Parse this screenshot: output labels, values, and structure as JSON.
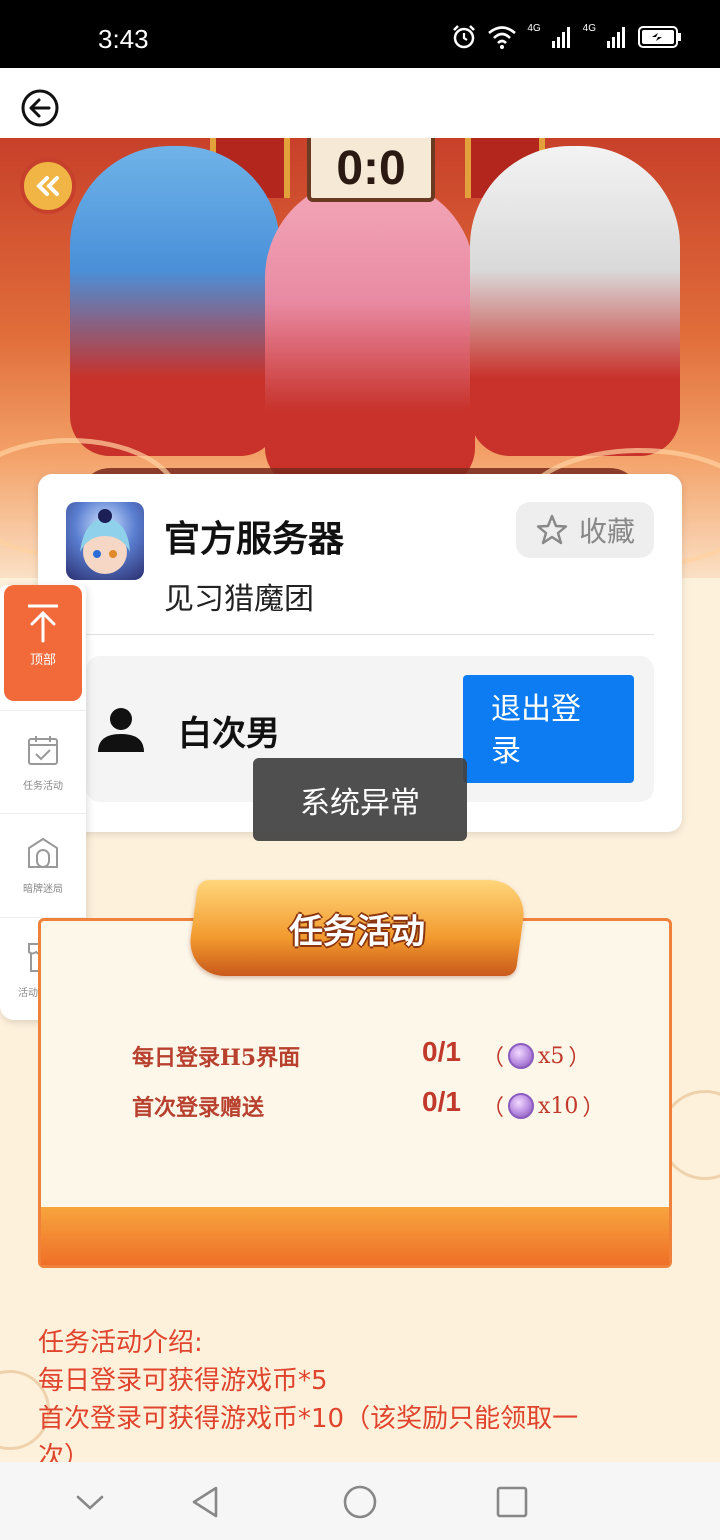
{
  "status_bar": {
    "time": "3:43",
    "network_1": "4G",
    "network_2": "4G"
  },
  "nav": {
    "back_icon": "back-arrow-icon"
  },
  "hero": {
    "score": "0:0"
  },
  "server_card": {
    "server_name": "官方服务器",
    "game_name": "见习猎魔团",
    "favorite_label": "收藏",
    "user_name": "白次男",
    "logout_label": "退出登录"
  },
  "toast": {
    "message": "系统异常"
  },
  "side_menu": {
    "top_label": "顶部",
    "items": [
      {
        "label": "任务活动",
        "icon": "calendar-check-icon"
      },
      {
        "label": "暗牌迷局",
        "icon": "card-building-icon"
      },
      {
        "label": "活动交易所",
        "icon": "shop-icon"
      }
    ]
  },
  "task_panel": {
    "title": "任务活动",
    "tasks": [
      {
        "name": "每日登录H5界面",
        "progress": "0/1",
        "reward": "x5"
      },
      {
        "name": "首次登录赠送",
        "progress": "0/1",
        "reward": "x10"
      }
    ]
  },
  "intro": {
    "heading": "任务活动介绍:",
    "line1": "每日登录可获得游戏币*5",
    "line2": "首次登录可获得游戏币*10（该奖励只能领取一",
    "line3": "次）"
  },
  "colors": {
    "accent_blue": "#0d7cf2",
    "accent_orange": "#f26a3a",
    "intro_red": "#e0442d"
  }
}
